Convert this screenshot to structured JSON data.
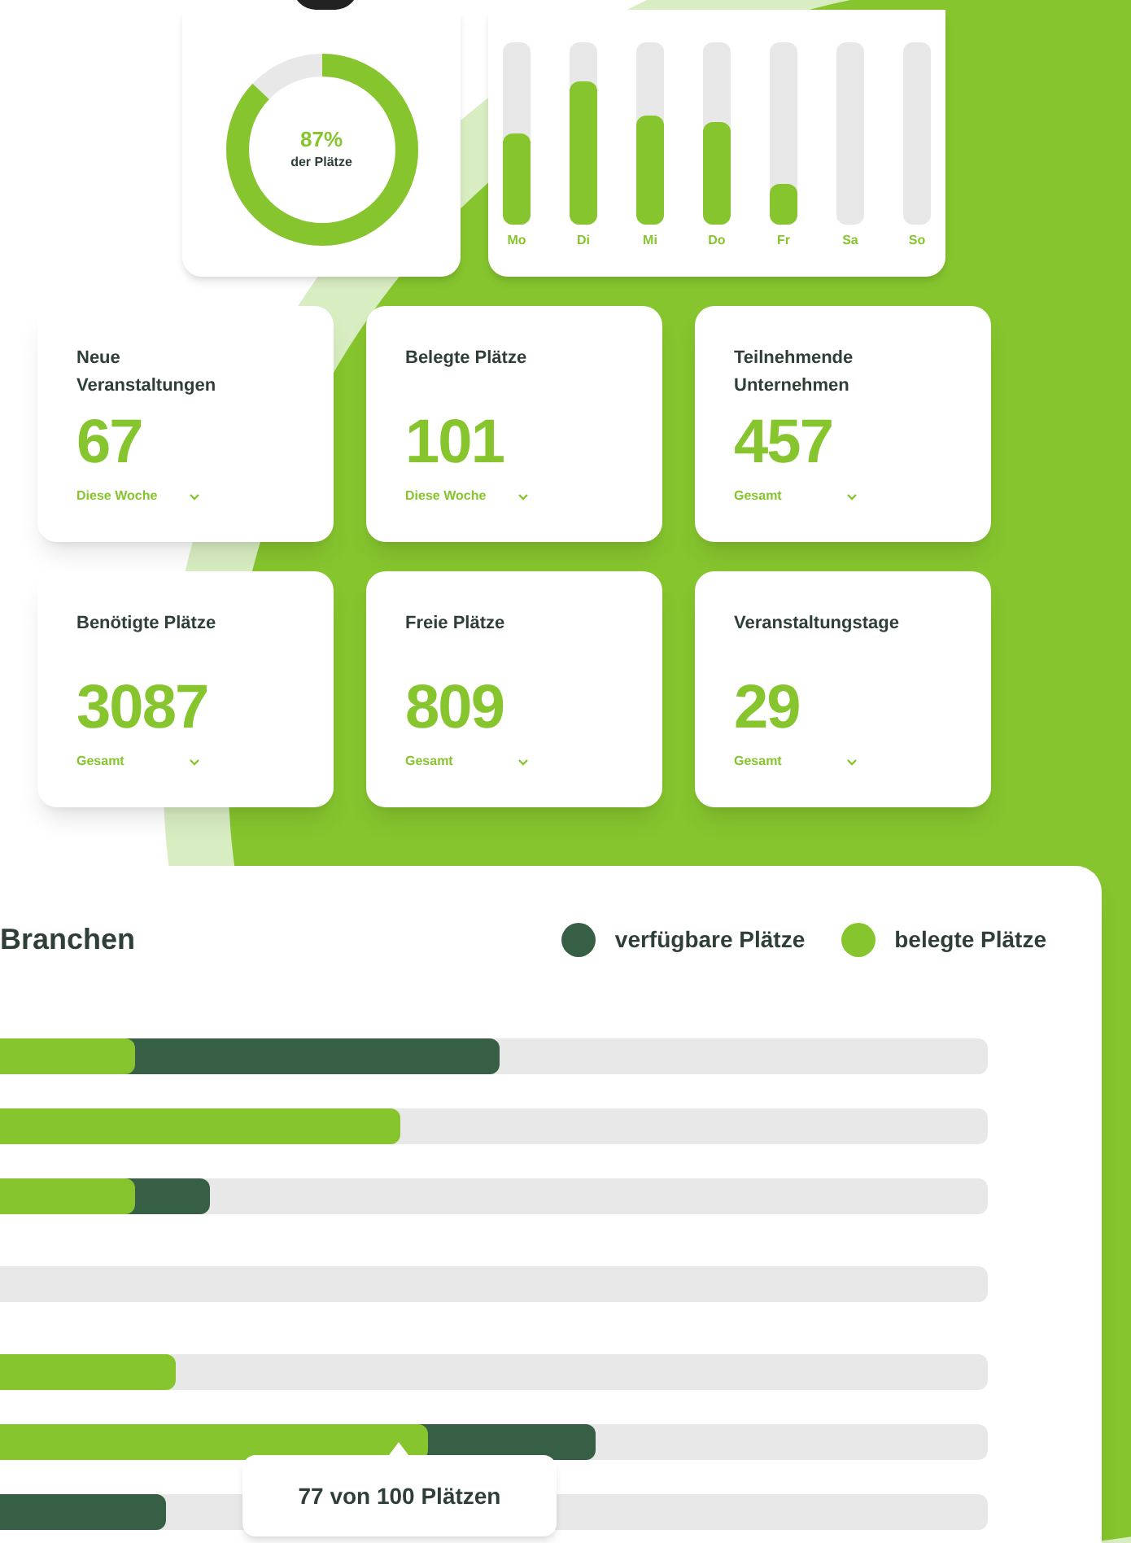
{
  "occupancy": {
    "value": "87%",
    "caption": "der Plätze",
    "level": 0.87
  },
  "weekdays": [
    {
      "label": "Mo",
      "level": 0.5
    },
    {
      "label": "Di",
      "level": 0.79
    },
    {
      "label": "Mi",
      "level": 0.6
    },
    {
      "label": "Do",
      "level": 0.56
    },
    {
      "label": "Fr",
      "level": 0.22
    },
    {
      "label": "Sa"
    },
    {
      "label": "So"
    }
  ],
  "stats": [
    {
      "title": "Neue Veranstaltungen",
      "value": "67",
      "period": "Diese Woche"
    },
    {
      "title": "Belegte Plätze",
      "value": "101",
      "period": "Diese Woche"
    },
    {
      "title": "Teilnehmende Unternehmen",
      "value": "457",
      "period": "Gesamt"
    },
    {
      "title": "Benötigte Plätze",
      "value": "3087",
      "period": "Gesamt"
    },
    {
      "title": "Freie Plätze",
      "value": "809",
      "period": "Gesamt"
    },
    {
      "title": "Veranstaltungstage",
      "value": "29",
      "period": "Gesamt"
    }
  ],
  "branchen": {
    "title": "Branchen",
    "legend": [
      {
        "label": "verfügbare Plätze",
        "color": "#365f45"
      },
      {
        "label": "belegte Plätze",
        "color": "#86c52e"
      }
    ],
    "rows": [
      {
        "segments": [
          {
            "kind": "available",
            "level": 0.506
          },
          {
            "kind": "occupied",
            "level": 0.137
          }
        ]
      },
      {
        "segments": [
          {
            "kind": "occupied",
            "level": 0.405
          }
        ]
      },
      {
        "segments": [
          {
            "kind": "available",
            "level": 0.212
          },
          {
            "kind": "occupied",
            "level": 0.137
          }
        ]
      },
      {
        "segments": []
      },
      {
        "segments": [
          {
            "kind": "occupied",
            "level": 0.178
          }
        ]
      },
      {
        "segments": [
          {
            "kind": "available",
            "level": 0.603
          },
          {
            "kind": "occupied",
            "level": 0.433
          }
        ]
      },
      {
        "segments": [
          {
            "kind": "available",
            "level": 0.168
          }
        ]
      }
    ],
    "tooltip": "77 von 100 Plätzen"
  }
}
